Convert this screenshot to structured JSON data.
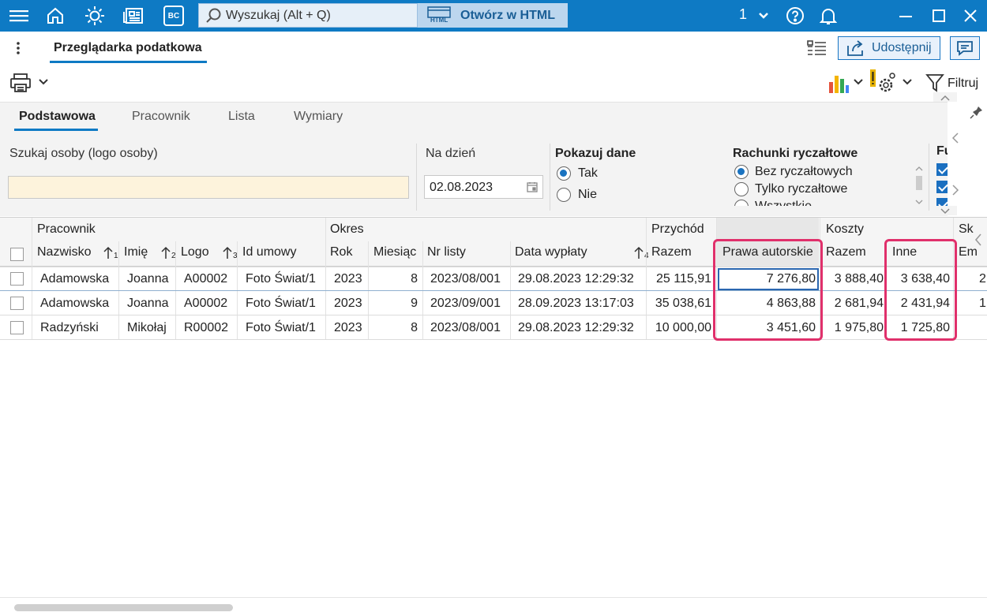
{
  "titlebar": {
    "search_placeholder": "Wyszukaj (Alt + Q)",
    "open_html_label": "Otwórz w HTML",
    "html_badge": "HTML",
    "bc_badge": "BC",
    "user_number": "1",
    "accent_color": "#0e7ac4"
  },
  "page": {
    "tab_title": "Przeglądarka podatkowa",
    "share_label": "Udostępnij",
    "filter_label": "Filtruj"
  },
  "filter": {
    "tabs": [
      "Podstawowa",
      "Pracownik",
      "Lista",
      "Wymiary"
    ],
    "search_person_label": "Szukaj osoby (logo osoby)",
    "search_person_value": "",
    "date_label": "Na dzień",
    "date_value": "02.08.2023",
    "show_data_label": "Pokazuj dane",
    "show_data_options": [
      "Tak",
      "Nie"
    ],
    "show_data_selected": "Tak",
    "lump_label": "Rachunki ryczałtowe",
    "lump_options": [
      "Bez ryczałtowych",
      "Tylko ryczałtowe",
      "Wszystkie"
    ],
    "lump_selected": "Bez ryczałtowych",
    "extra_label": "Fu"
  },
  "grid": {
    "groups": {
      "employee": "Pracownik",
      "period": "Okres",
      "income": "Przychód",
      "costs": "Koszty",
      "sk": "Sk"
    },
    "columns": {
      "surname": "Nazwisko",
      "surname_sort": "1",
      "name": "Imię",
      "name_sort": "2",
      "logo": "Logo",
      "logo_sort": "3",
      "contract": "Id umowy",
      "year": "Rok",
      "month": "Miesiąc",
      "list_no": "Nr listy",
      "pay_date": "Data wypłaty",
      "pay_date_sort": "4",
      "income_total": "Razem",
      "copyright": "Prawa autorskie",
      "costs_total": "Razem",
      "other": "Inne",
      "em": "Em"
    },
    "rows": [
      {
        "surname": "Adamowska",
        "name": "Joanna",
        "logo": "A00002",
        "contract": "Foto Świat/1",
        "year": "2023",
        "month": "8",
        "list_no": "2023/08/001",
        "pay_date": "29.08.2023 12:29:32",
        "income_total": "25 115,91",
        "copyright": "7 276,80",
        "costs_total": "3 888,40",
        "other": "3 638,40",
        "em": "2"
      },
      {
        "surname": "Adamowska",
        "name": "Joanna",
        "logo": "A00002",
        "contract": "Foto Świat/1",
        "year": "2023",
        "month": "9",
        "list_no": "2023/09/001",
        "pay_date": "28.09.2023 13:17:03",
        "income_total": "35 038,61",
        "copyright": "4 863,88",
        "costs_total": "2 681,94",
        "other": "2 431,94",
        "em": "1"
      },
      {
        "surname": "Radzyński",
        "name": "Mikołaj",
        "logo": "R00002",
        "contract": "Foto Świat/1",
        "year": "2023",
        "month": "8",
        "list_no": "2023/08/001",
        "pay_date": "29.08.2023 12:29:32",
        "income_total": "10 000,00",
        "copyright": "3 451,60",
        "costs_total": "1 975,80",
        "other": "1 725,80",
        "em": ""
      }
    ],
    "highlight_color": "#e0306b"
  }
}
